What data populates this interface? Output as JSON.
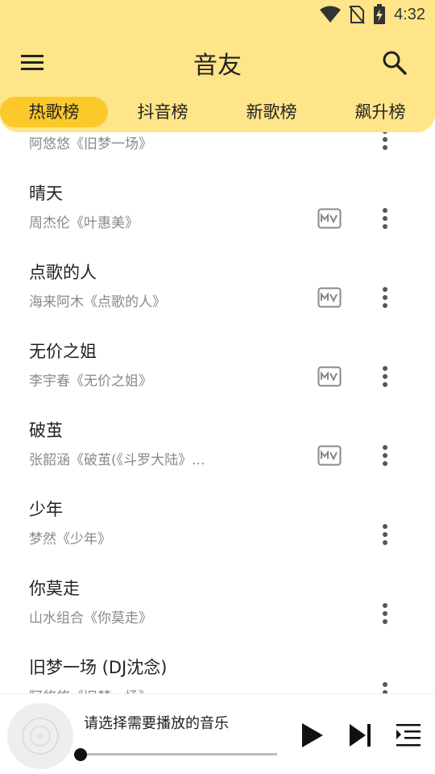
{
  "status": {
    "time": "4:32",
    "icons": [
      "wifi-icon",
      "no-sim-icon",
      "battery-charging-icon"
    ]
  },
  "app": {
    "title": "音友"
  },
  "tabs": [
    {
      "label": "热歌榜",
      "active": true
    },
    {
      "label": "抖音榜",
      "active": false
    },
    {
      "label": "新歌榜",
      "active": false
    },
    {
      "label": "飙升榜",
      "active": false
    }
  ],
  "songs": [
    {
      "title": "",
      "subtitle": "阿悠悠《旧梦一场》",
      "has_mv": false
    },
    {
      "title": "晴天",
      "subtitle": "周杰伦《叶惠美》",
      "has_mv": true
    },
    {
      "title": "点歌的人",
      "subtitle": "海来阿木《点歌的人》",
      "has_mv": true
    },
    {
      "title": "无价之姐",
      "subtitle": "李宇春《无价之姐》",
      "has_mv": true
    },
    {
      "title": "破茧",
      "subtitle": "张韶涵《破茧(《斗罗大陆》...",
      "has_mv": true
    },
    {
      "title": "少年",
      "subtitle": "梦然《少年》",
      "has_mv": false
    },
    {
      "title": "你莫走",
      "subtitle": "山水组合《你莫走》",
      "has_mv": false
    },
    {
      "title": "旧梦一场 (DJ沈念)",
      "subtitle": "阿悠悠《旧梦一场》",
      "has_mv": false
    }
  ],
  "player": {
    "text": "请选择需要播放的音乐",
    "progress": 0
  },
  "colors": {
    "header": "#ffe58a",
    "active_tab": "#fcc92b"
  }
}
